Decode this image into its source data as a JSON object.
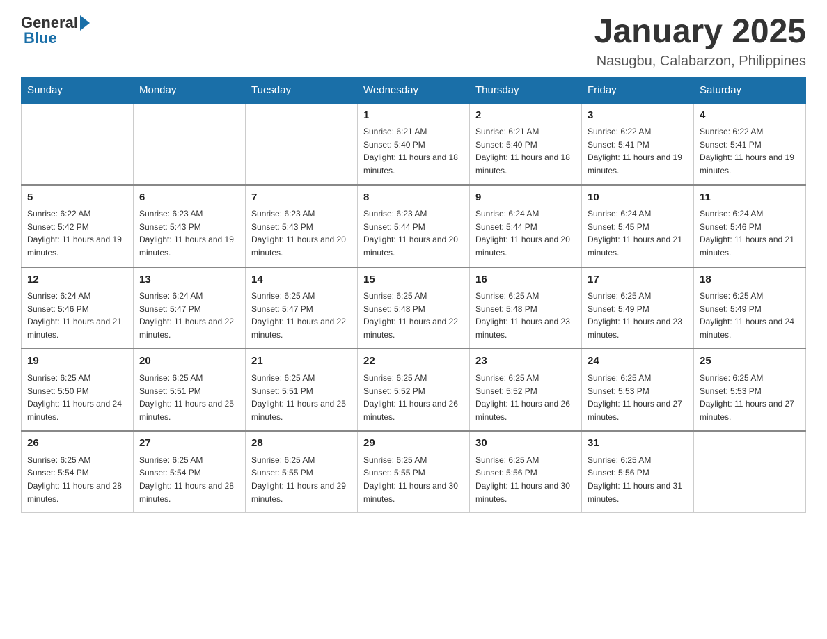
{
  "header": {
    "logo_general": "General",
    "logo_blue": "Blue",
    "main_title": "January 2025",
    "subtitle": "Nasugbu, Calabarzon, Philippines"
  },
  "calendar": {
    "days_of_week": [
      "Sunday",
      "Monday",
      "Tuesday",
      "Wednesday",
      "Thursday",
      "Friday",
      "Saturday"
    ],
    "weeks": [
      [
        {
          "day": "",
          "sunrise": "",
          "sunset": "",
          "daylight": ""
        },
        {
          "day": "",
          "sunrise": "",
          "sunset": "",
          "daylight": ""
        },
        {
          "day": "",
          "sunrise": "",
          "sunset": "",
          "daylight": ""
        },
        {
          "day": "1",
          "sunrise": "Sunrise: 6:21 AM",
          "sunset": "Sunset: 5:40 PM",
          "daylight": "Daylight: 11 hours and 18 minutes."
        },
        {
          "day": "2",
          "sunrise": "Sunrise: 6:21 AM",
          "sunset": "Sunset: 5:40 PM",
          "daylight": "Daylight: 11 hours and 18 minutes."
        },
        {
          "day": "3",
          "sunrise": "Sunrise: 6:22 AM",
          "sunset": "Sunset: 5:41 PM",
          "daylight": "Daylight: 11 hours and 19 minutes."
        },
        {
          "day": "4",
          "sunrise": "Sunrise: 6:22 AM",
          "sunset": "Sunset: 5:41 PM",
          "daylight": "Daylight: 11 hours and 19 minutes."
        }
      ],
      [
        {
          "day": "5",
          "sunrise": "Sunrise: 6:22 AM",
          "sunset": "Sunset: 5:42 PM",
          "daylight": "Daylight: 11 hours and 19 minutes."
        },
        {
          "day": "6",
          "sunrise": "Sunrise: 6:23 AM",
          "sunset": "Sunset: 5:43 PM",
          "daylight": "Daylight: 11 hours and 19 minutes."
        },
        {
          "day": "7",
          "sunrise": "Sunrise: 6:23 AM",
          "sunset": "Sunset: 5:43 PM",
          "daylight": "Daylight: 11 hours and 20 minutes."
        },
        {
          "day": "8",
          "sunrise": "Sunrise: 6:23 AM",
          "sunset": "Sunset: 5:44 PM",
          "daylight": "Daylight: 11 hours and 20 minutes."
        },
        {
          "day": "9",
          "sunrise": "Sunrise: 6:24 AM",
          "sunset": "Sunset: 5:44 PM",
          "daylight": "Daylight: 11 hours and 20 minutes."
        },
        {
          "day": "10",
          "sunrise": "Sunrise: 6:24 AM",
          "sunset": "Sunset: 5:45 PM",
          "daylight": "Daylight: 11 hours and 21 minutes."
        },
        {
          "day": "11",
          "sunrise": "Sunrise: 6:24 AM",
          "sunset": "Sunset: 5:46 PM",
          "daylight": "Daylight: 11 hours and 21 minutes."
        }
      ],
      [
        {
          "day": "12",
          "sunrise": "Sunrise: 6:24 AM",
          "sunset": "Sunset: 5:46 PM",
          "daylight": "Daylight: 11 hours and 21 minutes."
        },
        {
          "day": "13",
          "sunrise": "Sunrise: 6:24 AM",
          "sunset": "Sunset: 5:47 PM",
          "daylight": "Daylight: 11 hours and 22 minutes."
        },
        {
          "day": "14",
          "sunrise": "Sunrise: 6:25 AM",
          "sunset": "Sunset: 5:47 PM",
          "daylight": "Daylight: 11 hours and 22 minutes."
        },
        {
          "day": "15",
          "sunrise": "Sunrise: 6:25 AM",
          "sunset": "Sunset: 5:48 PM",
          "daylight": "Daylight: 11 hours and 22 minutes."
        },
        {
          "day": "16",
          "sunrise": "Sunrise: 6:25 AM",
          "sunset": "Sunset: 5:48 PM",
          "daylight": "Daylight: 11 hours and 23 minutes."
        },
        {
          "day": "17",
          "sunrise": "Sunrise: 6:25 AM",
          "sunset": "Sunset: 5:49 PM",
          "daylight": "Daylight: 11 hours and 23 minutes."
        },
        {
          "day": "18",
          "sunrise": "Sunrise: 6:25 AM",
          "sunset": "Sunset: 5:49 PM",
          "daylight": "Daylight: 11 hours and 24 minutes."
        }
      ],
      [
        {
          "day": "19",
          "sunrise": "Sunrise: 6:25 AM",
          "sunset": "Sunset: 5:50 PM",
          "daylight": "Daylight: 11 hours and 24 minutes."
        },
        {
          "day": "20",
          "sunrise": "Sunrise: 6:25 AM",
          "sunset": "Sunset: 5:51 PM",
          "daylight": "Daylight: 11 hours and 25 minutes."
        },
        {
          "day": "21",
          "sunrise": "Sunrise: 6:25 AM",
          "sunset": "Sunset: 5:51 PM",
          "daylight": "Daylight: 11 hours and 25 minutes."
        },
        {
          "day": "22",
          "sunrise": "Sunrise: 6:25 AM",
          "sunset": "Sunset: 5:52 PM",
          "daylight": "Daylight: 11 hours and 26 minutes."
        },
        {
          "day": "23",
          "sunrise": "Sunrise: 6:25 AM",
          "sunset": "Sunset: 5:52 PM",
          "daylight": "Daylight: 11 hours and 26 minutes."
        },
        {
          "day": "24",
          "sunrise": "Sunrise: 6:25 AM",
          "sunset": "Sunset: 5:53 PM",
          "daylight": "Daylight: 11 hours and 27 minutes."
        },
        {
          "day": "25",
          "sunrise": "Sunrise: 6:25 AM",
          "sunset": "Sunset: 5:53 PM",
          "daylight": "Daylight: 11 hours and 27 minutes."
        }
      ],
      [
        {
          "day": "26",
          "sunrise": "Sunrise: 6:25 AM",
          "sunset": "Sunset: 5:54 PM",
          "daylight": "Daylight: 11 hours and 28 minutes."
        },
        {
          "day": "27",
          "sunrise": "Sunrise: 6:25 AM",
          "sunset": "Sunset: 5:54 PM",
          "daylight": "Daylight: 11 hours and 28 minutes."
        },
        {
          "day": "28",
          "sunrise": "Sunrise: 6:25 AM",
          "sunset": "Sunset: 5:55 PM",
          "daylight": "Daylight: 11 hours and 29 minutes."
        },
        {
          "day": "29",
          "sunrise": "Sunrise: 6:25 AM",
          "sunset": "Sunset: 5:55 PM",
          "daylight": "Daylight: 11 hours and 30 minutes."
        },
        {
          "day": "30",
          "sunrise": "Sunrise: 6:25 AM",
          "sunset": "Sunset: 5:56 PM",
          "daylight": "Daylight: 11 hours and 30 minutes."
        },
        {
          "day": "31",
          "sunrise": "Sunrise: 6:25 AM",
          "sunset": "Sunset: 5:56 PM",
          "daylight": "Daylight: 11 hours and 31 minutes."
        },
        {
          "day": "",
          "sunrise": "",
          "sunset": "",
          "daylight": ""
        }
      ]
    ]
  }
}
